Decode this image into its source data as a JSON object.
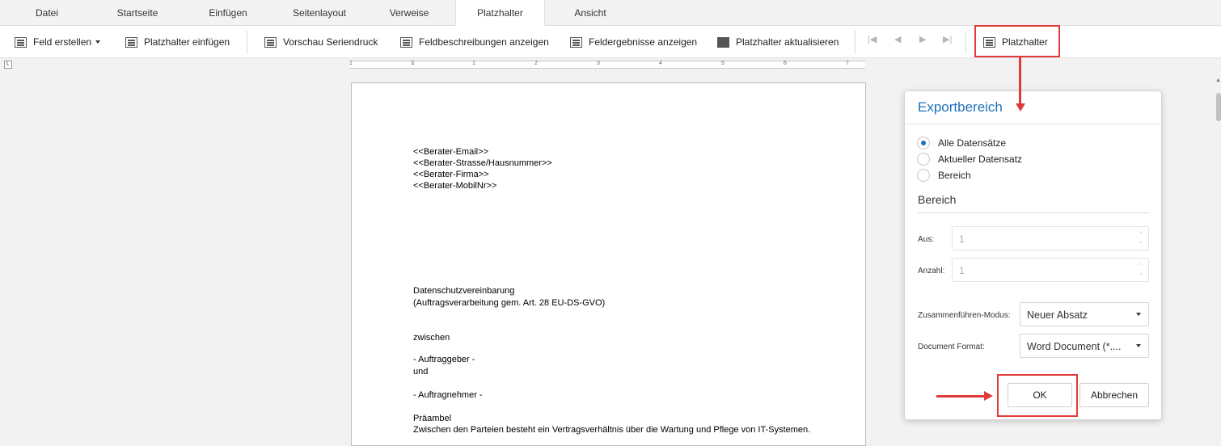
{
  "tabs": [
    {
      "label": "Datei"
    },
    {
      "label": "Startseite"
    },
    {
      "label": "Einfügen"
    },
    {
      "label": "Seitenlayout"
    },
    {
      "label": "Verweise"
    },
    {
      "label": "Platzhalter",
      "active": true
    },
    {
      "label": "Ansicht"
    }
  ],
  "toolbar": {
    "feld_erstellen": "Feld erstellen",
    "platzhalter_einfuegen": "Platzhalter einfügen",
    "vorschau_seriendruck": "Vorschau Seriendruck",
    "feldbeschreibungen": "Feldbeschreibungen anzeigen",
    "feldergebnisse": "Feldergebnisse anzeigen",
    "platzhalter_aktualisieren": "Platzhalter aktualisieren",
    "platzhalter": "Platzhalter"
  },
  "ruler": {
    "marks": [
      "1",
      "1",
      "2",
      "3",
      "4",
      "5",
      "6",
      "7"
    ]
  },
  "document": {
    "lines": [
      "<<Berater-Email>>",
      "<<Berater-Strasse/Hausnummer>>",
      "<<Berater-Firma>>",
      "<<Berater-MobilNr>>",
      "Datenschutzvereinbarung",
      "(Auftragsverarbeitung gem. Art. 28 EU-DS-GVO)",
      "zwischen",
      "- Auftraggeber -",
      "und",
      "- Auftragnehmer -",
      "Präambel",
      "Zwischen den Parteien besteht ein Vertragsverhältnis über die Wartung und Pflege von IT-Systemen."
    ]
  },
  "dialog": {
    "title": "Exportbereich",
    "options": [
      "Alle Datensätze",
      "Aktueller Datensatz",
      "Bereich"
    ],
    "selected_option": "Alle Datensätze",
    "section_title": "Bereich",
    "aus_label": "Aus:",
    "aus_value": "1",
    "anzahl_label": "Anzahl:",
    "anzahl_value": "1",
    "merge_label": "Zusammenführen-Modus:",
    "merge_value": "Neuer Absatz",
    "format_label": "Document Format:",
    "format_value": "Word Document (*....",
    "ok": "OK",
    "cancel": "Abbrechen"
  },
  "colors": {
    "accent": "#1f70b8",
    "annotation": "#e03b3b"
  }
}
